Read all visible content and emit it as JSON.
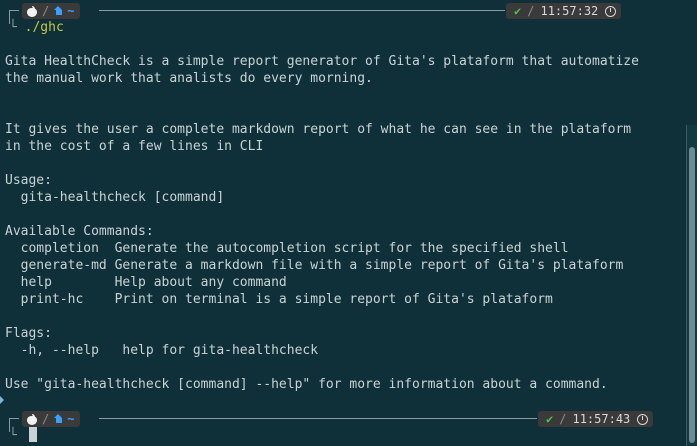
{
  "prompt_top": {
    "os_icon": "apple-icon",
    "home_icon": "home-icon",
    "path": "~",
    "status_mark": "✔",
    "time": "11:57:32",
    "time_icon": "clock-icon"
  },
  "command": "./ghc",
  "output": [
    "Gita HealthCheck is a simple report generator of Gita's plataform that automatize",
    "the manual work that analists do every morning.",
    "",
    "",
    "It gives the user a complete markdown report of what he can see in the plataform",
    "in the cost of a few lines in CLI",
    "",
    "Usage:",
    "  gita-healthcheck [command]",
    "",
    "Available Commands:",
    "  completion  Generate the autocompletion script for the specified shell",
    "  generate-md Generate a markdown file with a simple report of Gita's plataform",
    "  help        Help about any command",
    "  print-hc    Print on terminal is a simple report of Gita's plataform",
    "",
    "Flags:",
    "  -h, --help   help for gita-healthcheck",
    "",
    "Use \"gita-healthcheck [command] --help\" for more information about a command."
  ],
  "prompt_bottom": {
    "os_icon": "apple-icon",
    "home_icon": "home-icon",
    "path": "~",
    "status_mark": "✔",
    "time": "11:57:43",
    "time_icon": "clock-icon"
  },
  "colors": {
    "background": "#0f3038",
    "text": "#c9d3d5",
    "command": "#c3c94a",
    "home": "#3aa0ff",
    "ok": "#4cc34c",
    "segment": "#3a3a3a"
  }
}
